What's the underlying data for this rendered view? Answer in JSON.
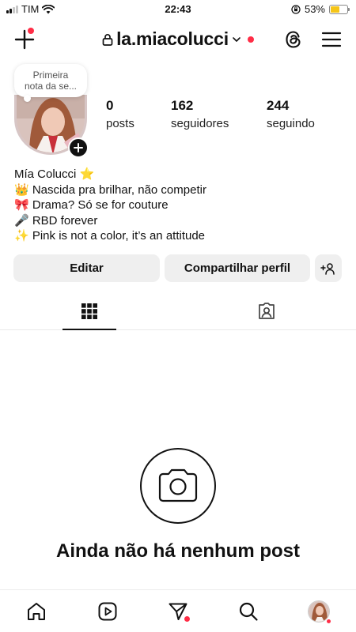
{
  "status_bar": {
    "carrier": "TIM",
    "time": "22:43",
    "battery_percent": "53%",
    "battery_level": 0.53
  },
  "header": {
    "username": "la.miacolucci",
    "icons": [
      "plus-icon",
      "lock-icon",
      "chevron-down-icon",
      "threads-icon",
      "menu-icon"
    ]
  },
  "note": {
    "text_line1": "Primeira",
    "text_line2": "nota da se..."
  },
  "stats": {
    "posts": {
      "value": "0",
      "label": "posts"
    },
    "followers": {
      "value": "162",
      "label": "seguidores"
    },
    "following": {
      "value": "244",
      "label": "seguindo"
    }
  },
  "bio": {
    "name": "Mía Colucci ⭐",
    "lines": [
      "👑 Nascida pra brilhar, não competir",
      "🎀 Drama? Só se for couture",
      "🎤 RBD forever",
      "✨ Pink is not a color, it’s an attitude"
    ]
  },
  "buttons": {
    "edit": "Editar",
    "share": "Compartilhar perfil"
  },
  "empty_state": {
    "title": "Ainda não há nenhum post"
  },
  "colors": {
    "notification_red": "#ff2d46",
    "button_bg": "#efefef",
    "battery_yellow": "#f5c518"
  }
}
